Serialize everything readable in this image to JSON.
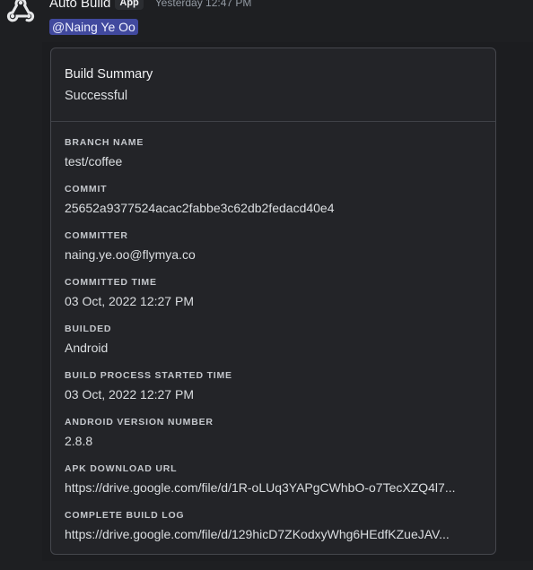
{
  "message": {
    "author": "Auto Build",
    "badge": "App",
    "timestamp": "Yesterday 12:47 PM",
    "mention": "@Naing Ye Oo",
    "avatar_icon": "webhook-icon"
  },
  "embed": {
    "title": "Build Summary",
    "status": "Successful",
    "fields": [
      {
        "name": "BRANCH NAME",
        "value": "test/coffee"
      },
      {
        "name": "COMMIT",
        "value": "25652a9377524acac2fabbe3c62db2fedacd40e4"
      },
      {
        "name": "COMMITTER",
        "value": "naing.ye.oo@flymya.co"
      },
      {
        "name": "COMMITTED TIME",
        "value": "03 Oct, 2022 12:27 PM"
      },
      {
        "name": "BUILDED",
        "value": "Android"
      },
      {
        "name": "BUILD PROCESS STARTED TIME",
        "value": "03 Oct, 2022 12:27 PM"
      },
      {
        "name": "ANDROID VERSION NUMBER",
        "value": "2.8.8"
      },
      {
        "name": "APK DOWNLOAD URL",
        "value": "https://drive.google.com/file/d/1R-oLUq3YAPgCWhbO-o7TecXZQ4l7..."
      },
      {
        "name": "COMPLETE BUILD LOG",
        "value": "https://drive.google.com/file/d/129hicD7ZKodxyWhg6HEdfKZueJAV..."
      }
    ]
  },
  "colors": {
    "background": "#1e1f22",
    "embed_background": "#232428",
    "mention": "#5865f2"
  }
}
